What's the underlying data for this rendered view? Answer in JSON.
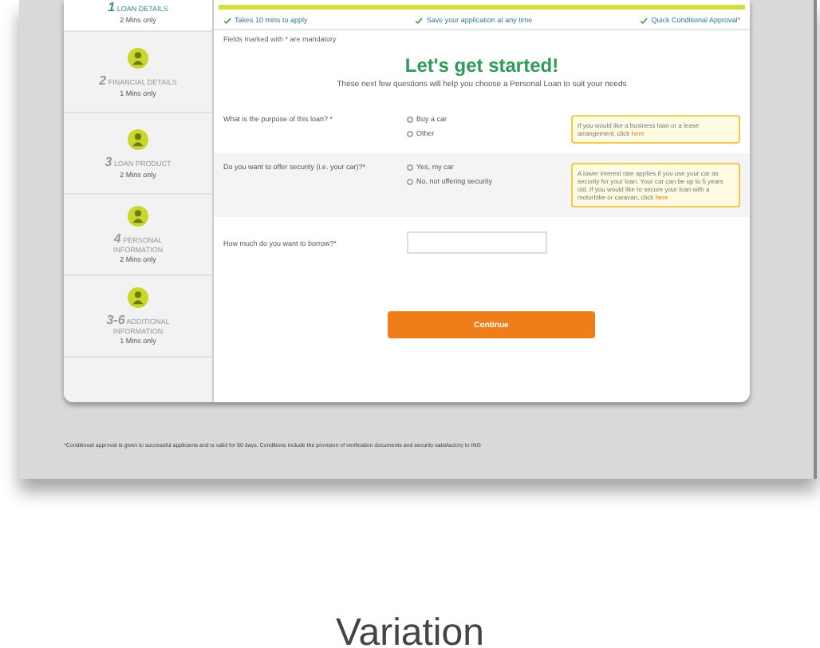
{
  "sidebar": {
    "items": [
      {
        "number": "1",
        "label": "LOAN DETAILS",
        "time": "2 Mins only",
        "selected": true
      },
      {
        "number": "2",
        "label": "FINANCIAL DETAILS",
        "time": "1 Mins only",
        "selected": false
      },
      {
        "number": "3",
        "label": "LOAN PRODUCT",
        "time": "2 Mins only",
        "selected": false
      },
      {
        "number": "4",
        "label": "PERSONAL INFORMATION",
        "time": "2 Mins only",
        "selected": false
      },
      {
        "number": "3-6",
        "label": "ADDITIONAL INFORMATION",
        "time": "1 Mins only",
        "selected": false
      }
    ]
  },
  "benefits": [
    "Takes 10 mins to apply",
    "Save your application at any time",
    "Quick Conditional Approval*"
  ],
  "mandatory_note": "Fields marked with * are mandatory",
  "heading": "Let's get started!",
  "subheading": "These next few questions will help you choose a Personal Loan to suit your needs",
  "questions": [
    {
      "kind": "radio",
      "label": "What is the purpose of this loan? *",
      "options": [
        {
          "label": "Buy a car",
          "selected": false
        },
        {
          "label": "Other",
          "selected": false
        }
      ],
      "tip": {
        "text": "If you would like a business loan or a lease arrangement, click",
        "link": "here"
      }
    },
    {
      "kind": "radio",
      "label": "Do you want to offer security (i.e. your car)?*",
      "options": [
        {
          "label": "Yes, my car",
          "selected": false
        },
        {
          "label": "No, not offering security",
          "selected": false
        }
      ],
      "tip": {
        "text": "A lower interest rate applies if you use your car as security for your loan. Your car can be up to 5 years old. If you would like to secure your loan with a motorbike or caravan, click",
        "link": "here"
      }
    },
    {
      "kind": "input",
      "label": "How much do you want to borrow?*"
    }
  ],
  "button": "Continue",
  "footer": "*Conditional approval is given to successful applicants and is valid for 90 days. Conditions include the provision of verification documents and security satisfactory to ING",
  "caption": "Variation"
}
